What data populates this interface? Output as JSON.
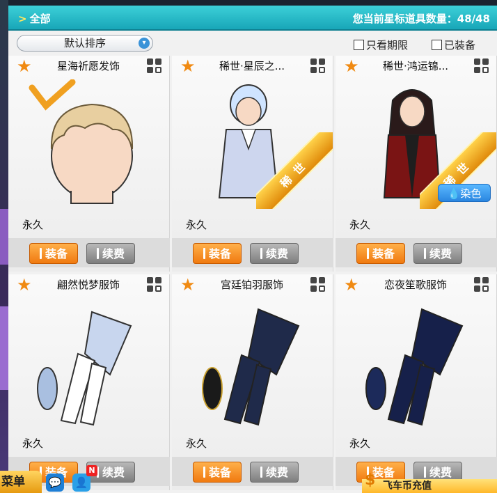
{
  "header": {
    "tab_label": "全部",
    "count_label": "您当前星标道具数量：48/48"
  },
  "toolbar": {
    "sort_label": "默认排序",
    "filter_expiring": "只看期限",
    "filter_equipped": "已装备"
  },
  "items": [
    {
      "name": "星海祈愿发饰",
      "duration": "永久",
      "equip": "装备",
      "renew": "续费",
      "rare": false,
      "dye": false
    },
    {
      "name": "稀世·星辰之...",
      "duration": "永久",
      "equip": "装备",
      "renew": "续费",
      "rare": true,
      "dye": false
    },
    {
      "name": "稀世·鸿运锦...",
      "duration": "永久",
      "equip": "装备",
      "renew": "续费",
      "rare": true,
      "dye": true
    },
    {
      "name": "翩然悦梦服饰",
      "duration": "永久",
      "equip": "装备",
      "renew": "续费",
      "rare": false,
      "dye": false
    },
    {
      "name": "宫廷铂羽服饰",
      "duration": "永久",
      "equip": "装备",
      "renew": "续费",
      "rare": false,
      "dye": false
    },
    {
      "name": "恋夜笙歌服饰",
      "duration": "永久",
      "equip": "装备",
      "renew": "续费",
      "rare": false,
      "dye": false
    }
  ],
  "badges": {
    "rare_label": "稀世",
    "dye_label": "染色",
    "new_label": "N"
  },
  "bottom": {
    "menu_label": "菜单",
    "recharge_label": "飞车币充值"
  },
  "colors": {
    "header": "#18a6b8",
    "equip_button": "#f07a10",
    "renew_button": "#7e7e7e",
    "star": "#f08a12"
  }
}
